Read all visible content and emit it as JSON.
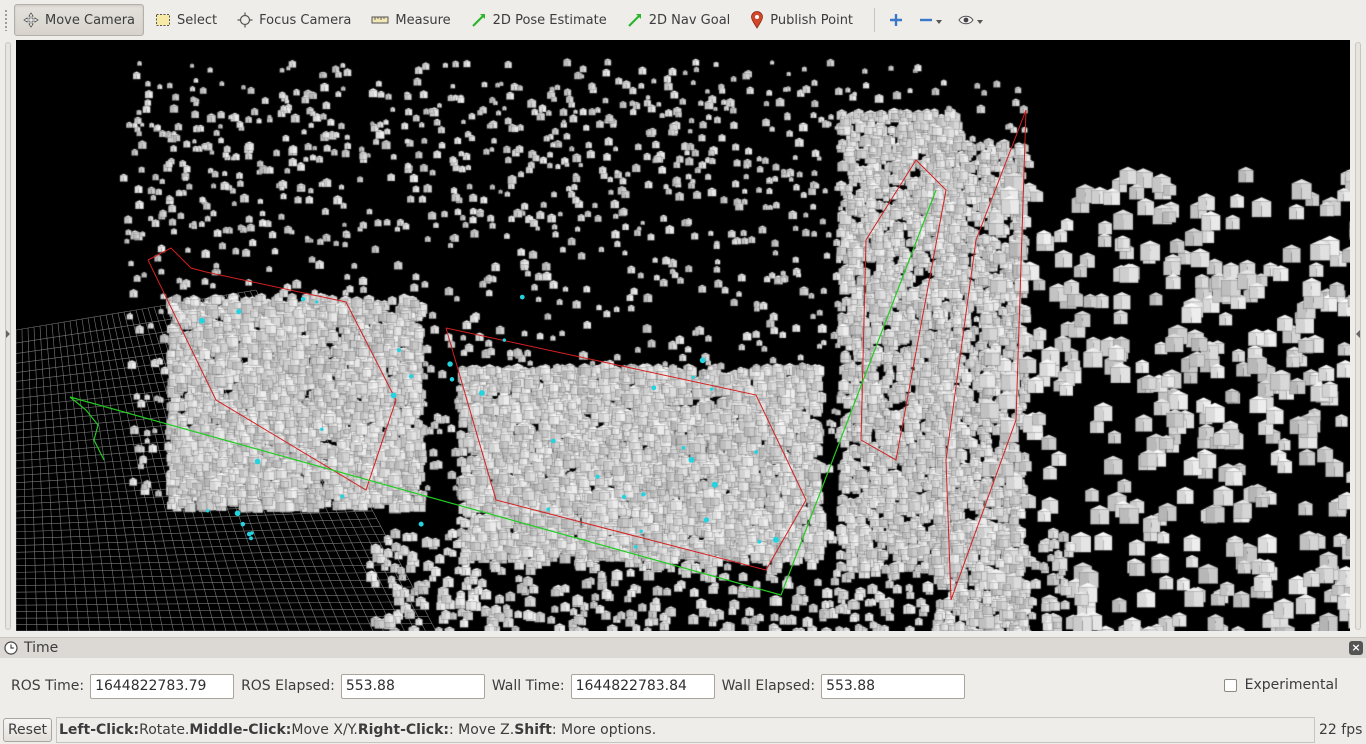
{
  "toolbar": {
    "tools": [
      {
        "label": "Move Camera",
        "icon": "move-camera-icon"
      },
      {
        "label": "Select",
        "icon": "select-icon"
      },
      {
        "label": "Focus Camera",
        "icon": "focus-camera-icon"
      },
      {
        "label": "Measure",
        "icon": "measure-icon"
      },
      {
        "label": "2D Pose Estimate",
        "icon": "pose-estimate-icon"
      },
      {
        "label": "2D Nav Goal",
        "icon": "nav-goal-icon"
      },
      {
        "label": "Publish Point",
        "icon": "map-pin-icon"
      }
    ],
    "active_tool": "Move Camera",
    "extra_icons": [
      "plus-icon",
      "minus-icon",
      "eye-icon"
    ]
  },
  "time_panel": {
    "title": "Time",
    "ros_time_label": "ROS Time:",
    "ros_time": "1644822783.79",
    "ros_elapsed_label": "ROS Elapsed:",
    "ros_elapsed": "553.88",
    "wall_time_label": "Wall Time:",
    "wall_time": "1644822783.84",
    "wall_elapsed_label": "Wall Elapsed:",
    "wall_elapsed": "553.88",
    "experimental_label": "Experimental",
    "experimental_checked": false
  },
  "status_bar": {
    "reset_label": "Reset",
    "hint": [
      {
        "bold": "Left-Click:",
        "text": " Rotate. "
      },
      {
        "bold": "Middle-Click:",
        "text": " Move X/Y. "
      },
      {
        "bold": "Right-Click:",
        "text": ": Move Z. "
      },
      {
        "bold": "Shift",
        "text": ": More options."
      }
    ],
    "fps": "22 fps"
  },
  "colors": {
    "background": "#000000",
    "grid": "#7a7a7a",
    "bounding_box": "#d42020",
    "path": "#22cc22",
    "points_cyan": "#22d3e0",
    "voxel": "#f4f4f4"
  }
}
